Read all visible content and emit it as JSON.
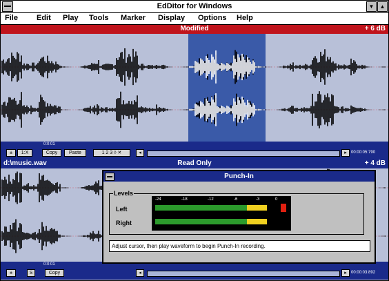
{
  "window": {
    "title": "EdDitor for Windows",
    "minimize_glyph": "▼",
    "maximize_glyph": "▲"
  },
  "menu": [
    "File",
    "Edit",
    "Play",
    "Tools",
    "Marker",
    "Display",
    "Options",
    "Help"
  ],
  "track1": {
    "status": "Modified",
    "gain": "+ 6 dB",
    "header_color": "#c0141c",
    "toolbar": {
      "time_top": "0:0:01",
      "buttons": [
        "Copy",
        "Paste"
      ],
      "time_readout": "00:00:05:790"
    }
  },
  "track2": {
    "filename": "d:\\music.wav",
    "status": "Read Only",
    "gain": "+ 4 dB",
    "header_color": "#1a2a8a",
    "toolbar": {
      "time_top": "0:0:01",
      "buttons": [
        "S",
        "Copy"
      ],
      "time_readout": "00:00:03:892"
    }
  },
  "punch_in": {
    "title": "Punch-In",
    "group_label": "Levels",
    "channels": [
      {
        "label": "Left",
        "level": 0.9
      },
      {
        "label": "Right",
        "level": 0.9
      }
    ],
    "scale": [
      "-24",
      "-18",
      "-12",
      "-6",
      "-3",
      "0"
    ],
    "status": "Adjust cursor, then play waveform to begin Punch-In recording."
  },
  "colors": {
    "accent": "#1a2a8a",
    "selection": "#3a5aa8",
    "meter_green": "#2c9a2c",
    "meter_yellow": "#f0d020",
    "meter_red": "#e02010"
  },
  "icons": [
    "system-menu-icon",
    "minimize-icon",
    "maximize-icon"
  ]
}
